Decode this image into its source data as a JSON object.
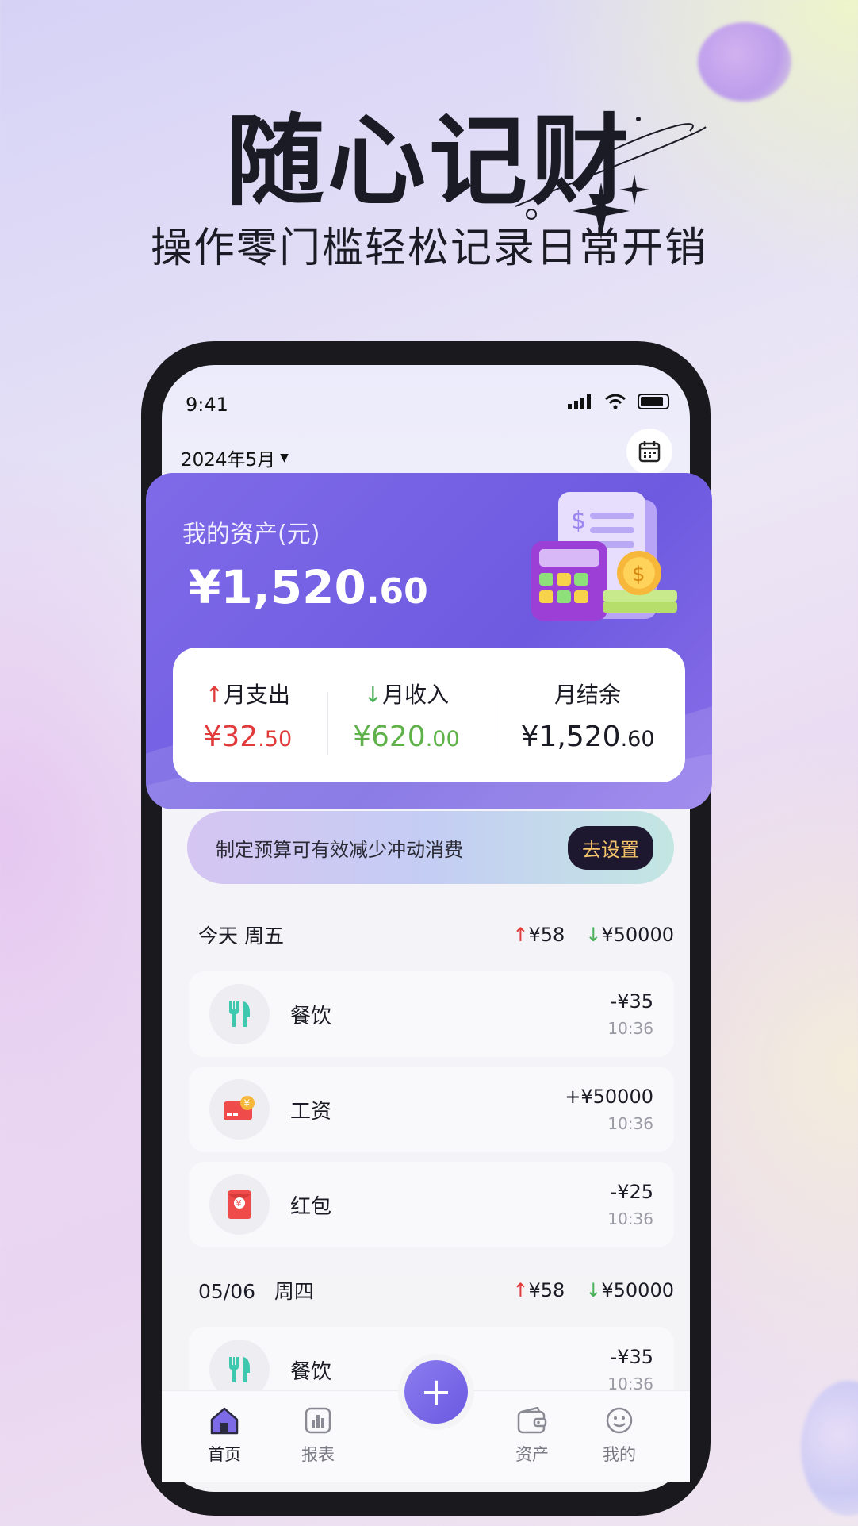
{
  "promo": {
    "headline": "随心记财",
    "subline": "操作零门槛轻松记录日常开销"
  },
  "status_bar": {
    "time": "9:41"
  },
  "header": {
    "month": "2024年5月"
  },
  "asset_card": {
    "title": "我的资产(元)",
    "amount_main": "¥1,520",
    "amount_decimal": ".60"
  },
  "summary": {
    "expense": {
      "label": "月支出",
      "main": "¥32",
      "decimal": ".50"
    },
    "income": {
      "label": "月收入",
      "main": "¥620",
      "decimal": ".00"
    },
    "balance": {
      "label": "月结余",
      "main": "¥1,520",
      "decimal": ".60"
    }
  },
  "budget": {
    "text": "制定预算可有效减少冲动消费",
    "button": "去设置"
  },
  "days": [
    {
      "label": "今天 周五",
      "out": "¥58",
      "in": "¥50000",
      "items": [
        {
          "name": "餐饮",
          "amount": "-¥35",
          "time": "10:36",
          "icon": "utensils-icon"
        },
        {
          "name": "工资",
          "amount": "+¥50000",
          "time": "10:36",
          "icon": "salary-card-icon"
        },
        {
          "name": "红包",
          "amount": "-¥25",
          "time": "10:36",
          "icon": "red-packet-icon"
        }
      ]
    },
    {
      "label": "05/06   周四",
      "out": "¥58",
      "in": "¥50000",
      "items": [
        {
          "name": "餐饮",
          "amount": "-¥35",
          "time": "10:36",
          "icon": "utensils-icon"
        }
      ]
    }
  ],
  "tabbar": {
    "home": "首页",
    "report": "报表",
    "assets": "资产",
    "mine": "我的"
  },
  "colors": {
    "accent": "#6d5ae0",
    "expense": "#e03a3a",
    "income": "#5fb24a",
    "food_icon": "#3fc8b0",
    "button_text": "#f5c36a"
  }
}
